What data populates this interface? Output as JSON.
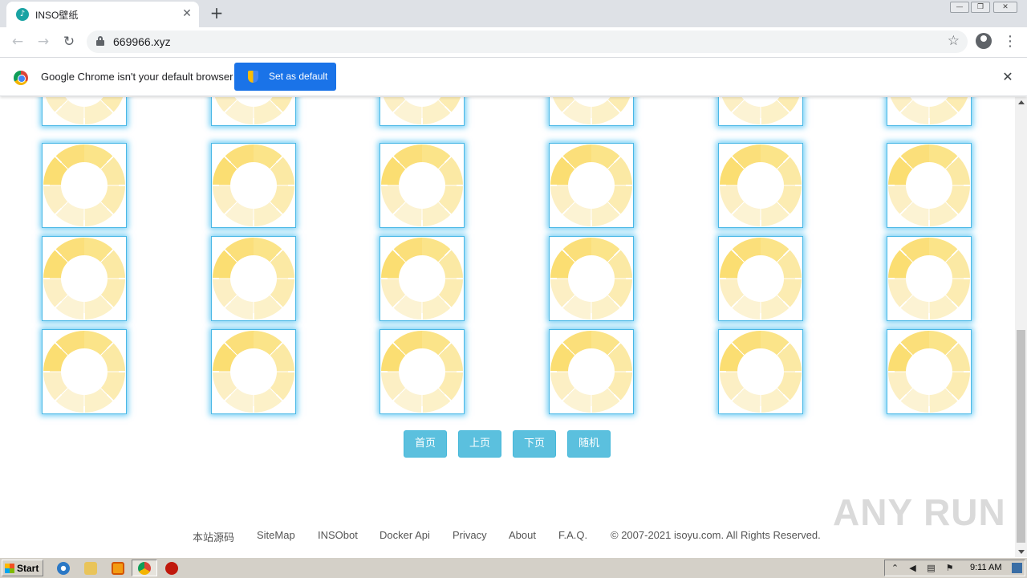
{
  "browser": {
    "tab_title": "INSO壁纸",
    "tab_favicon": "inso-favicon",
    "new_tab_icon": "plus-icon",
    "close_tab_icon": "close-icon",
    "url": "669966.xyz",
    "window_controls": [
      "minimize-icon",
      "restore-icon",
      "close-icon"
    ]
  },
  "infobar": {
    "message": "Google Chrome isn't your default browser",
    "button_label": "Set as default",
    "close_icon": "close-icon"
  },
  "gallery": {
    "item_icon": "loading-spinner-icon",
    "columns": 6,
    "visible_rows": 4
  },
  "pager": {
    "first": "首页",
    "prev": "上页",
    "next": "下页",
    "random": "随机"
  },
  "footer": {
    "links": [
      "本站源码",
      "SiteMap",
      "INSObot",
      "Docker Api",
      "Privacy",
      "About",
      "F.A.Q."
    ],
    "copyright": "© 2007-2021 isoyu.com. All Rights Reserved."
  },
  "watermark": "ANY RUN",
  "taskbar": {
    "start_label": "Start",
    "clock": "9:11 AM",
    "apps": [
      "ie-icon",
      "explorer-icon",
      "media-player-icon",
      "chrome-icon",
      "stop-icon"
    ]
  }
}
